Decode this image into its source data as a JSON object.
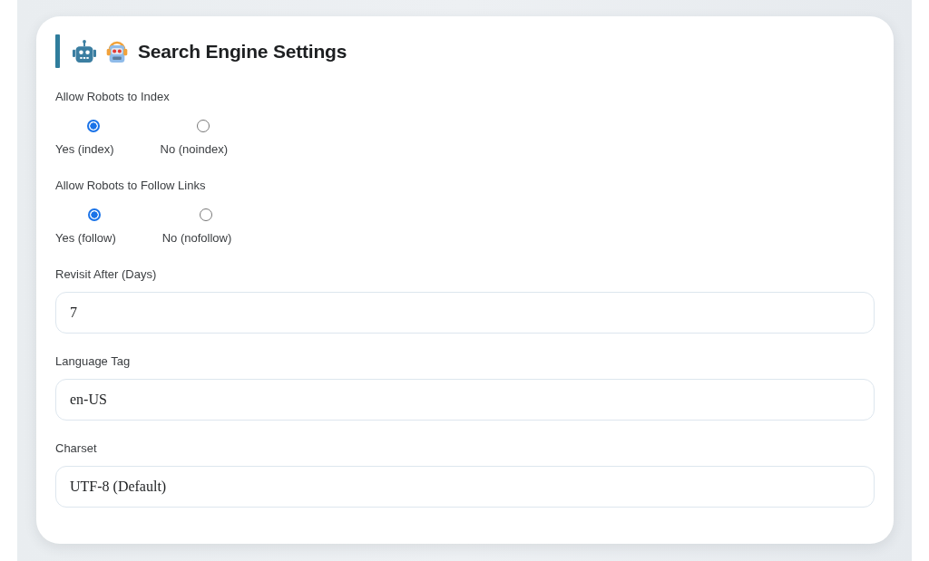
{
  "section": {
    "title": "Search Engine Settings",
    "fields": [
      {
        "kind": "radio",
        "label": "Allow Robots to Index",
        "options": [
          {
            "label": "Yes (index)",
            "selected": true
          },
          {
            "label": "No (noindex)",
            "selected": false
          }
        ]
      },
      {
        "kind": "radio",
        "label": "Allow Robots to Follow Links",
        "options": [
          {
            "label": "Yes (follow)",
            "selected": true
          },
          {
            "label": "No (nofollow)",
            "selected": false
          }
        ]
      },
      {
        "kind": "text",
        "label": "Revisit After (Days)",
        "value": "7"
      },
      {
        "kind": "text",
        "label": "Language Tag",
        "value": "en-US"
      },
      {
        "kind": "text",
        "label": "Charset",
        "value": "UTF-8 (Default)"
      }
    ]
  }
}
